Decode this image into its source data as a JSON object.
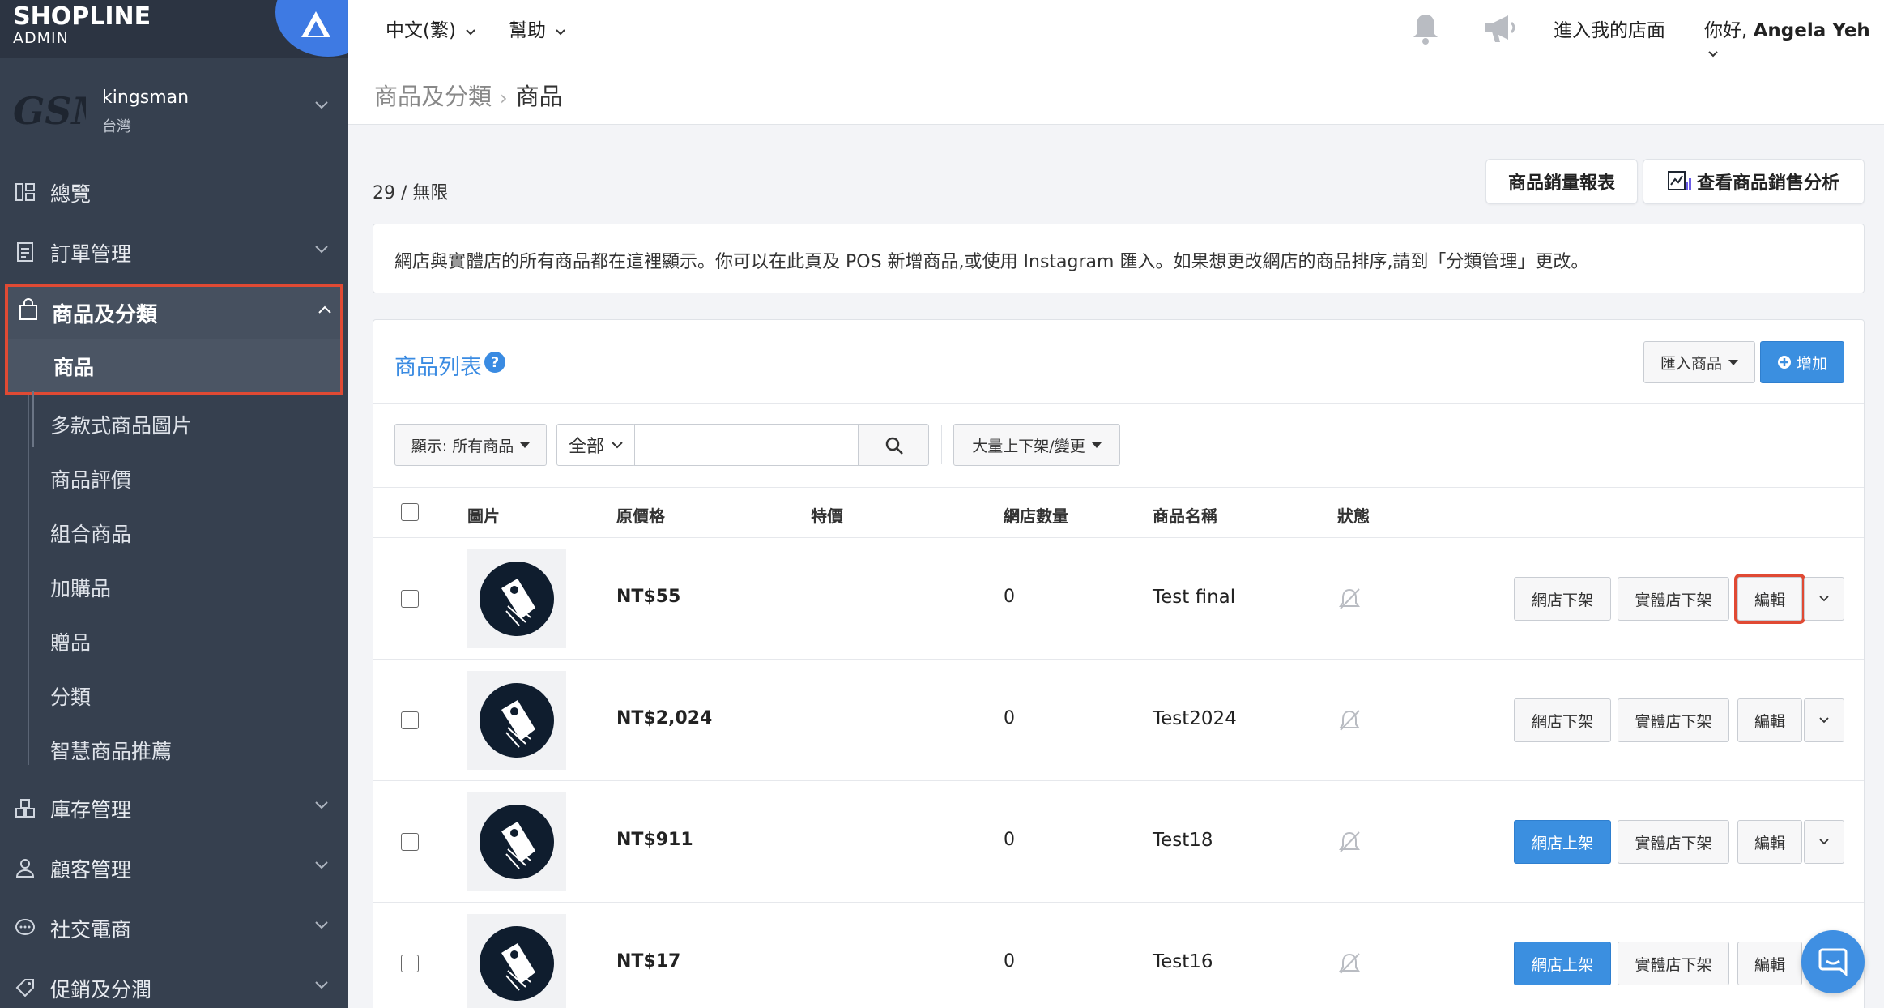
{
  "brand": {
    "name": "SHOPLINE",
    "sub": "ADMIN"
  },
  "store": {
    "logo_text": "GSM",
    "name": "kingsman",
    "region": "台灣"
  },
  "sidebar": {
    "items": [
      {
        "label": "總覽",
        "icon": "dashboard-icon"
      },
      {
        "label": "訂單管理",
        "icon": "order-icon"
      },
      {
        "label": "商品及分類",
        "icon": "bag-icon"
      },
      {
        "label": "庫存管理",
        "icon": "inventory-icon"
      },
      {
        "label": "顧客管理",
        "icon": "customer-icon"
      },
      {
        "label": "社交電商",
        "icon": "chat-bubble-icon"
      },
      {
        "label": "促銷及分潤",
        "icon": "tag-icon"
      }
    ],
    "product_sub": [
      "商品",
      "多款式商品圖片",
      "商品評價",
      "組合商品",
      "加購品",
      "贈品",
      "分類",
      "智慧商品推薦"
    ]
  },
  "topbar": {
    "language": "中文(繁)",
    "help": "幫助",
    "enter_store": "進入我的店面",
    "greeting": "你好,",
    "user": "Angela Yeh"
  },
  "breadcrumb": {
    "parent": "商品及分類",
    "current": "商品"
  },
  "quota": "29 / 無限",
  "buttons": {
    "sales_report": "商品銷量報表",
    "sales_analysis": "查看商品銷售分析"
  },
  "info": "網店與實體店的所有商品都在這裡顯示。你可以在此頁及 POS 新增商品,或使用 Instagram 匯入。如果想更改網店的商品排序,請到「分類管理」更改。",
  "panel": {
    "title": "商品列表",
    "import": "匯入商品",
    "add": "增加",
    "filter": "顯示: 所有商品",
    "scope": "全部",
    "search_placeholder": "",
    "bulk": "大量上下架/變更"
  },
  "table": {
    "headers": [
      "圖片",
      "原價格",
      "特價",
      "網店數量",
      "商品名稱",
      "狀態"
    ],
    "rows": [
      {
        "price": "NT$55",
        "qty": "0",
        "name": "Test final",
        "online_btn": "網店下架",
        "online_active": false,
        "store_btn": "實體店下架",
        "edit": "編輯"
      },
      {
        "price": "NT$2,024",
        "qty": "0",
        "name": "Test2024",
        "online_btn": "網店下架",
        "online_active": false,
        "store_btn": "實體店下架",
        "edit": "編輯"
      },
      {
        "price": "NT$911",
        "qty": "0",
        "name": "Test18",
        "online_btn": "網店上架",
        "online_active": true,
        "store_btn": "實體店下架",
        "edit": "編輯"
      },
      {
        "price": "NT$17",
        "qty": "0",
        "name": "Test16",
        "online_btn": "網店上架",
        "online_active": true,
        "store_btn": "實體店下架",
        "edit": "編輯"
      }
    ]
  },
  "colors": {
    "sidebar": "#36404f",
    "accent": "#3b8fe0",
    "highlight": "#e04a34"
  }
}
